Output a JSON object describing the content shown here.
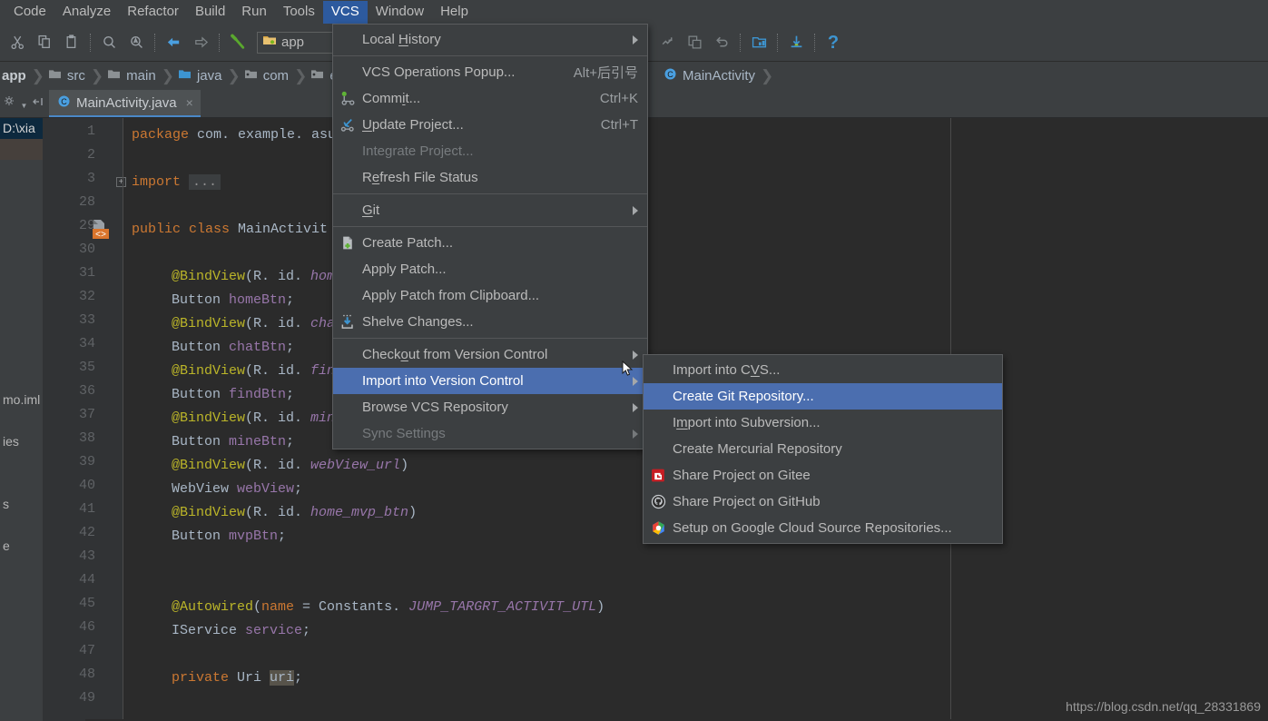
{
  "menubar": {
    "items": [
      {
        "label": "Code",
        "mnemonic": "C",
        "active": false
      },
      {
        "label": "Analyze",
        "mnemonic": "z",
        "active": false
      },
      {
        "label": "Refactor",
        "mnemonic": "R",
        "active": false
      },
      {
        "label": "Build",
        "mnemonic": "B",
        "active": false
      },
      {
        "label": "Run",
        "mnemonic": "u",
        "active": false
      },
      {
        "label": "Tools",
        "mnemonic": "T",
        "active": false
      },
      {
        "label": "VCS",
        "mnemonic": "V",
        "active": true
      },
      {
        "label": "Window",
        "mnemonic": "W",
        "active": false
      },
      {
        "label": "Help",
        "mnemonic": "H",
        "active": false
      }
    ]
  },
  "toolbar": {
    "icons": [
      "cut-icon",
      "copy-icon",
      "paste-icon",
      "find-icon",
      "replace-icon",
      "back-icon",
      "forward-icon",
      "build-hammer-icon"
    ],
    "module_selector": {
      "label": "app",
      "icon": "android-module-icon"
    },
    "right_icons": [
      "sync-gradle-icon",
      "avd-manager-icon",
      "undo-icon",
      "project-structure-icon",
      "sdk-manager-icon",
      "help-icon"
    ]
  },
  "breadcrumb": {
    "items": [
      {
        "label": "app",
        "icon": "module-icon"
      },
      {
        "label": "src",
        "icon": "folder-icon"
      },
      {
        "label": "main",
        "icon": "folder-icon"
      },
      {
        "label": "java",
        "icon": "source-folder-icon"
      },
      {
        "label": "com",
        "icon": "package-icon"
      },
      {
        "label": "e",
        "icon": "package-icon"
      }
    ],
    "right_items": [
      {
        "label": "MainActivity",
        "icon": "class-icon"
      }
    ]
  },
  "editor_tab": {
    "label": "MainActivity.java",
    "icon": "java-class-icon",
    "close": "×"
  },
  "project_panel": {
    "rows": [
      {
        "label": "D:\\xia",
        "state": "selected"
      },
      {
        "label": "",
        "state": "selected2"
      },
      {
        "label": ""
      },
      {
        "label": ""
      },
      {
        "label": ""
      },
      {
        "label": ""
      },
      {
        "label": ""
      },
      {
        "label": ""
      },
      {
        "label": ""
      },
      {
        "label": ""
      },
      {
        "label": ""
      },
      {
        "label": ""
      },
      {
        "label": ""
      },
      {
        "label": "mo.iml"
      },
      {
        "label": ""
      },
      {
        "label": "ies"
      },
      {
        "label": ""
      },
      {
        "label": ""
      },
      {
        "label": "s"
      },
      {
        "label": ""
      },
      {
        "label": "e"
      }
    ]
  },
  "code": {
    "line_numbers": [
      "1",
      "2",
      "3",
      "28",
      "29",
      "30",
      "31",
      "32",
      "33",
      "34",
      "35",
      "36",
      "37",
      "38",
      "39",
      "40",
      "41",
      "42",
      "43",
      "44",
      "45",
      "46",
      "47",
      "48",
      "49"
    ],
    "lines": [
      {
        "n": "1",
        "tokens": [
          {
            "t": "package ",
            "c": "kw"
          },
          {
            "t": "com. example. asus.",
            "c": "plain"
          }
        ]
      },
      {
        "n": "2",
        "tokens": []
      },
      {
        "n": "3",
        "fold": true,
        "tokens": [
          {
            "t": "import ",
            "c": "kw"
          },
          {
            "t": "...",
            "c": "foldbox"
          }
        ]
      },
      {
        "n": "28",
        "tokens": []
      },
      {
        "n": "29",
        "marker": "class-run-marker",
        "tokens": [
          {
            "t": "public class ",
            "c": "kw"
          },
          {
            "t": "MainActivit",
            "c": "ident"
          }
        ]
      },
      {
        "n": "30",
        "tokens": []
      },
      {
        "n": "31",
        "indent": 1,
        "tokens": [
          {
            "t": "@BindView",
            "c": "ann"
          },
          {
            "t": "(R. id. ",
            "c": "plain"
          },
          {
            "t": "home_",
            "c": "stat"
          }
        ]
      },
      {
        "n": "32",
        "indent": 1,
        "tokens": [
          {
            "t": "Button ",
            "c": "plain"
          },
          {
            "t": "homeBtn",
            "c": "fld"
          },
          {
            "t": ";",
            "c": "plain"
          }
        ]
      },
      {
        "n": "33",
        "indent": 1,
        "tokens": [
          {
            "t": "@BindView",
            "c": "ann"
          },
          {
            "t": "(R. id. ",
            "c": "plain"
          },
          {
            "t": "chat_",
            "c": "stat"
          }
        ]
      },
      {
        "n": "34",
        "indent": 1,
        "tokens": [
          {
            "t": "Button ",
            "c": "plain"
          },
          {
            "t": "chatBtn",
            "c": "fld"
          },
          {
            "t": ";",
            "c": "plain"
          }
        ]
      },
      {
        "n": "35",
        "indent": 1,
        "tokens": [
          {
            "t": "@BindView",
            "c": "ann"
          },
          {
            "t": "(R. id. ",
            "c": "plain"
          },
          {
            "t": "find_",
            "c": "stat"
          }
        ]
      },
      {
        "n": "36",
        "indent": 1,
        "tokens": [
          {
            "t": "Button ",
            "c": "plain"
          },
          {
            "t": "findBtn",
            "c": "fld"
          },
          {
            "t": ";",
            "c": "plain"
          }
        ]
      },
      {
        "n": "37",
        "indent": 1,
        "tokens": [
          {
            "t": "@BindView",
            "c": "ann"
          },
          {
            "t": "(R. id. ",
            "c": "plain"
          },
          {
            "t": "mine_",
            "c": "stat"
          }
        ]
      },
      {
        "n": "38",
        "indent": 1,
        "tokens": [
          {
            "t": "Button ",
            "c": "plain"
          },
          {
            "t": "mineBtn",
            "c": "fld"
          },
          {
            "t": ";",
            "c": "plain"
          }
        ]
      },
      {
        "n": "39",
        "indent": 1,
        "tokens": [
          {
            "t": "@BindView",
            "c": "ann"
          },
          {
            "t": "(R. id. ",
            "c": "plain"
          },
          {
            "t": "webView_url",
            "c": "stat"
          },
          {
            "t": ")",
            "c": "plain"
          }
        ]
      },
      {
        "n": "40",
        "indent": 1,
        "tokens": [
          {
            "t": "WebView ",
            "c": "plain"
          },
          {
            "t": "webView",
            "c": "fld"
          },
          {
            "t": ";",
            "c": "plain"
          }
        ]
      },
      {
        "n": "41",
        "indent": 1,
        "tokens": [
          {
            "t": "@BindView",
            "c": "ann"
          },
          {
            "t": "(R. id. ",
            "c": "plain"
          },
          {
            "t": "home_mvp_btn",
            "c": "stat"
          },
          {
            "t": ")",
            "c": "plain"
          }
        ]
      },
      {
        "n": "42",
        "indent": 1,
        "tokens": [
          {
            "t": "Button ",
            "c": "plain"
          },
          {
            "t": "mvpBtn",
            "c": "fld"
          },
          {
            "t": ";",
            "c": "plain"
          }
        ]
      },
      {
        "n": "43",
        "tokens": []
      },
      {
        "n": "44",
        "tokens": []
      },
      {
        "n": "45",
        "indent": 1,
        "tokens": [
          {
            "t": "@Autowired",
            "c": "ann"
          },
          {
            "t": "(",
            "c": "plain"
          },
          {
            "t": "name",
            "c": "kw2"
          },
          {
            "t": " = Constants. ",
            "c": "plain"
          },
          {
            "t": "JUMP_TARGRT_ACTIVIT_UTL",
            "c": "stat"
          },
          {
            "t": ")",
            "c": "plain"
          }
        ]
      },
      {
        "n": "46",
        "indent": 1,
        "tokens": [
          {
            "t": "IService ",
            "c": "plain"
          },
          {
            "t": "service",
            "c": "fld"
          },
          {
            "t": ";",
            "c": "plain"
          }
        ]
      },
      {
        "n": "47",
        "tokens": []
      },
      {
        "n": "48",
        "indent": 1,
        "tokens": [
          {
            "t": "private ",
            "c": "kw"
          },
          {
            "t": "Uri ",
            "c": "plain"
          },
          {
            "t": "uri",
            "c": "hl"
          },
          {
            "t": ";",
            "c": "plain"
          }
        ]
      },
      {
        "n": "49",
        "tokens": []
      }
    ]
  },
  "vcs_menu": {
    "items": [
      {
        "id": "local-history",
        "label": "Local History",
        "mnemonic": "H",
        "submenu": true
      },
      {
        "separator": true
      },
      {
        "id": "vcs-operations",
        "label": "VCS Operations Popup...",
        "accel": "Alt+后引号"
      },
      {
        "id": "commit",
        "label": "Commit...",
        "mnemonic": "i",
        "accel": "Ctrl+K",
        "icon": "commit-icon"
      },
      {
        "id": "update-project",
        "label": "Update Project...",
        "mnemonic": "U",
        "accel": "Ctrl+T",
        "icon": "update-icon"
      },
      {
        "id": "integrate-project",
        "label": "Integrate Project...",
        "disabled": true
      },
      {
        "id": "refresh-file-status",
        "label": "Refresh File Status",
        "mnemonic": "e"
      },
      {
        "separator": true
      },
      {
        "id": "git",
        "label": "Git",
        "mnemonic": "G",
        "submenu": true
      },
      {
        "separator": true
      },
      {
        "id": "create-patch",
        "label": "Create Patch...",
        "icon": "create-patch-icon"
      },
      {
        "id": "apply-patch",
        "label": "Apply Patch..."
      },
      {
        "id": "apply-patch-clipboard",
        "label": "Apply Patch from Clipboard..."
      },
      {
        "id": "shelve-changes",
        "label": "Shelve Changes...",
        "icon": "shelve-icon"
      },
      {
        "separator": true
      },
      {
        "id": "checkout-from-vc",
        "label": "Checkout from Version Control",
        "mnemonic": "o",
        "submenu": true
      },
      {
        "id": "import-into-vc",
        "label": "Import into Version Control",
        "submenu": true,
        "highlighted": true
      },
      {
        "id": "browse-vcs-repo",
        "label": "Browse VCS Repository",
        "submenu": true
      },
      {
        "id": "sync-settings",
        "label": "Sync Settings",
        "submenu": true,
        "disabled": true
      }
    ]
  },
  "import_submenu": {
    "items": [
      {
        "id": "import-into-cvs",
        "label": "Import into CVS...",
        "mnemonic": "V"
      },
      {
        "id": "create-git-repo",
        "label": "Create Git Repository...",
        "highlighted": true
      },
      {
        "id": "import-into-svn",
        "label": "Import into Subversion...",
        "mnemonic": "m"
      },
      {
        "id": "create-hg-repo",
        "label": "Create Mercurial Repository"
      },
      {
        "id": "share-gitee",
        "label": "Share Project on Gitee",
        "icon": "gitee-icon"
      },
      {
        "id": "share-github",
        "label": "Share Project on GitHub",
        "icon": "github-icon"
      },
      {
        "id": "setup-gcsr",
        "label": "Setup on Google Cloud Source Repositories...",
        "icon": "google-cloud-icon"
      }
    ]
  },
  "watermark": {
    "text": "https://blog.csdn.net/qq_28331869"
  },
  "colors": {
    "menu_bg": "#3c3f41",
    "menu_highlight": "#4b6eaf",
    "menubar_highlight": "#2d5a9e",
    "editor_bg": "#2b2b2b",
    "gutter_bg": "#313335",
    "text": "#bbbbbb",
    "code_text": "#a9b7c6",
    "keyword": "#cc7832",
    "annotation": "#bbb529",
    "field": "#9876aa",
    "tab_underline": "#4a88c7"
  }
}
